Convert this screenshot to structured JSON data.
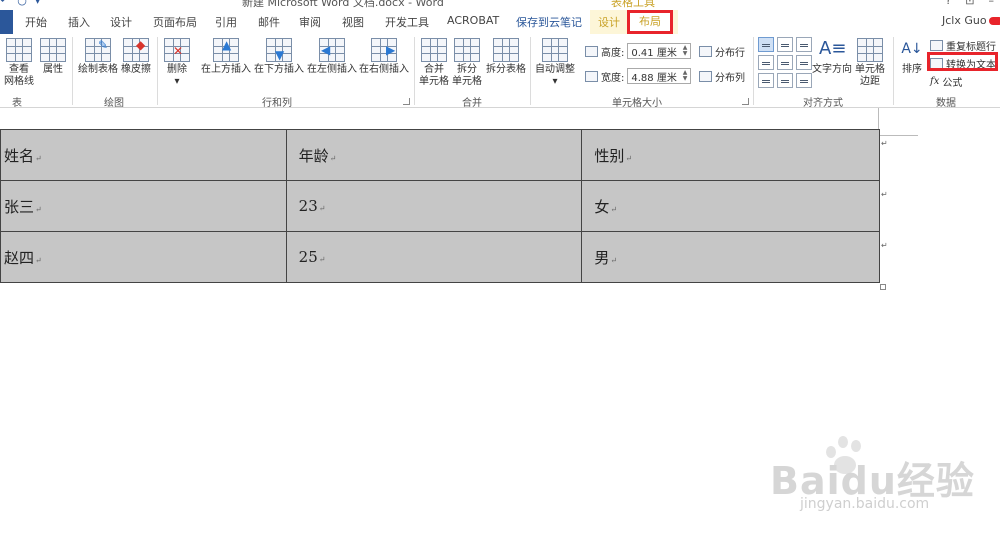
{
  "window": {
    "quick_access": [
      "↶",
      "○",
      "▾"
    ],
    "title": "新建 Microsoft Word 文档.docx - Word",
    "contextual_title": "表格工具",
    "controls": [
      "?",
      "⊡",
      "–"
    ]
  },
  "tabs": {
    "items": [
      {
        "label": "开始"
      },
      {
        "label": "插入"
      },
      {
        "label": "设计"
      },
      {
        "label": "页面布局"
      },
      {
        "label": "引用"
      },
      {
        "label": "邮件"
      },
      {
        "label": "审阅"
      },
      {
        "label": "视图"
      },
      {
        "label": "开发工具"
      },
      {
        "label": "ACROBAT"
      },
      {
        "label": "保存到云笔记"
      },
      {
        "label": "设计"
      },
      {
        "label": "布局"
      }
    ],
    "user": "Jclx Guo"
  },
  "ribbon": {
    "groups": {
      "table": "表",
      "draw": "绘图",
      "rows_cols": "行和列",
      "merge": "合并",
      "cell_size": "单元格大小",
      "alignment": "对齐方式",
      "data": "数据"
    },
    "buttons": {
      "view_gridlines": "查看",
      "view_gridlines_2": "网格线",
      "properties": "属性",
      "draw_table": "绘制表格",
      "eraser": "橡皮擦",
      "delete": "删除",
      "insert_above": "在上方插入",
      "insert_below": "在下方插入",
      "insert_left": "在左侧插入",
      "insert_right": "在右侧插入",
      "merge_cells": "合并",
      "merge_cells_2": "单元格",
      "split_cells": "拆分",
      "split_cells_2": "单元格",
      "split_table": "拆分表格",
      "autofit": "自动调整",
      "height_label": "高度:",
      "height_value": "0.41 厘米",
      "width_label": "宽度:",
      "width_value": "4.88 厘米",
      "distribute_rows": "分布行",
      "distribute_cols": "分布列",
      "text_direction": "文字方向",
      "cell_margins": "单元格",
      "cell_margins_2": "边距",
      "sort": "排序",
      "repeat_header": "重复标题行",
      "convert_to_text": "转换为文本",
      "formula": "公式"
    }
  },
  "table": {
    "rows": [
      [
        "姓名",
        "年龄",
        "性别"
      ],
      [
        "张三",
        "23",
        "女"
      ],
      [
        "赵四",
        "25",
        "男"
      ]
    ],
    "para_mark": "↵"
  },
  "watermark": {
    "brand": "Baidu经验",
    "url": "jingyan.baidu.com"
  },
  "colors": {
    "accent": "#2b579a",
    "contextual": "#c9a227",
    "highlight_box": "#e8242b",
    "table_fill": "#c6c6c6"
  }
}
